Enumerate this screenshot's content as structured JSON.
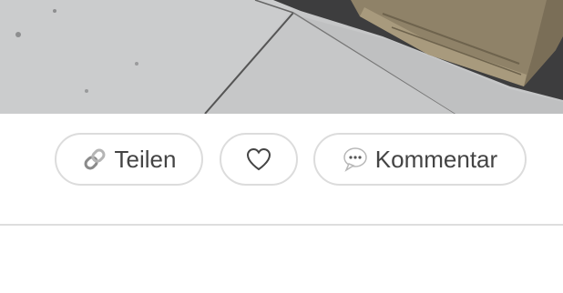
{
  "photo": {
    "alt_subject": "pavement-with-wooden-crate",
    "colors": {
      "concrete": "#c4c5c6",
      "wood": "#8b7d63",
      "shadow": "#3a3a3a"
    }
  },
  "actions": {
    "share": {
      "label": "Teilen",
      "icon": "link-icon"
    },
    "like": {
      "label": "",
      "icon": "heart-outline-icon"
    },
    "comment": {
      "label": "Kommentar",
      "icon": "speech-bubble-icon"
    }
  },
  "colors": {
    "button_border": "#dcdcdc",
    "button_text": "#444444",
    "divider": "#dedede"
  }
}
